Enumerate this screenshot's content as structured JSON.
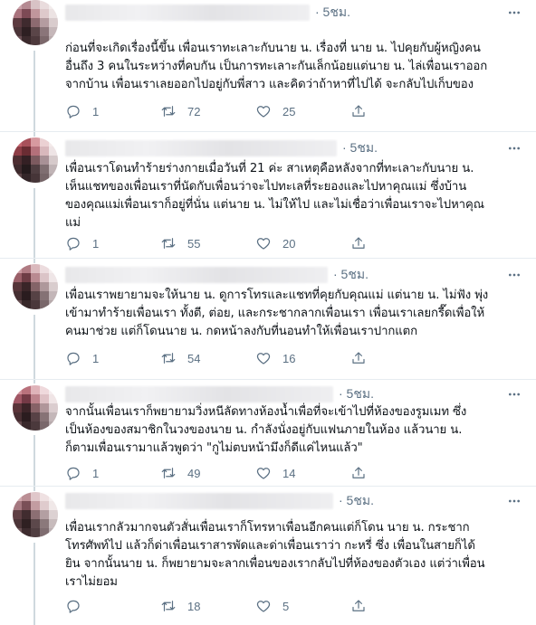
{
  "tweets": [
    {
      "time": "· 5ชม.",
      "text": "ก่อนที่จะเกิดเรื่องนี้ขึ้น เพื่อนเราทะเลาะกับนาย น. เรื่องที่ นาย น. ไปคุยกับผู้หญิงคน\nอื่นถึง 3 คนในระหว่างที่คบกัน เป็นการทะเลาะกันเล็กน้อยแต่นาย น. ไล่เพื่อนเราออก\nจากบ้าน เพื่อนเราเลยออกไปอยู่กับพี่สาว และคิดว่าถ้าหาที่ไปได้ จะกลับไปเก็บของ",
      "replies": "1",
      "retweets": "72",
      "likes": "25"
    },
    {
      "time": "· 5ชม.",
      "text": "เพื่อนเราโดนทำร้ายร่างกายเมื่อวันที่ 21 ค่ะ สาเหตุคือหลังจากที่ทะเลาะกับนาย น.\nเห็นแชทของเพื่อนเราที่นัดกับเพื่อนว่าจะไปทะเลที่ระยองและไปหาคุณแม่ ซึ่งบ้าน\nของคุณแม่เพื่อนเราก็อยู่ที่นั่น แต่นาย น. ไม่ให้ไป และไม่เชื่อว่าเพื่อนเราจะไปหาคุณ\nแม่",
      "replies": "1",
      "retweets": "55",
      "likes": "20"
    },
    {
      "time": "· 5ชม.",
      "text": "เพื่อนเราพยายามจะให้นาย น. ดูการโทรและแชทที่คุยกับคุณแม่ แต่นาย น. ไม่ฟัง พุ่ง\nเข้ามาทำร้ายเพื่อนเรา ทั้งตี, ต่อย, และกระชากลากเพื่อนเรา เพื่อนเราเลยกรี๊ดเพื่อให้\nคนมาช่วย แต่ก็โดนนาย น. กดหน้าลงกับที่นอนทำให้เพื่อนเราปากแตก",
      "replies": "1",
      "retweets": "54",
      "likes": "16"
    },
    {
      "time": "· 5ชม.",
      "text": "จากนั้นเพื่อนเราก็พยายามวิ่งหนีลัดทางห้องน้ำเพื่อที่จะเข้าไปที่ห้องของรูมเมท ซึ่ง\nเป็นห้องของสมาชิกในวงของนาย น. กำลังนั่งอยู่กับแฟนภายในห้อง แล้วนาย น.\nก็ตามเพื่อนเรามาแล้วพูดว่า \"กูไม่ตบหน้ามึงก็ดีแค่ไหนแล้ว\"",
      "replies": "1",
      "retweets": "49",
      "likes": "14"
    },
    {
      "time": "· 5ชม.",
      "text": "เพื่อนเรากลัวมากจนตัวสั่นเพื่อนเราก็โทรหาเพื่อนอีกคนแต่ก็โดน นาย น. กระชาก\nโทรศัพท์ไป แล้วก็ด่าเพื่อนเราสารพัดและด่าเพื่อนเราว่า กะหรี่ ซึ่ง เพื่อนในสายก็ได้\nยิน จากนั้นนาย น. ก็พยายามจะลากเพื่อนของเรากลับไปที่ห้องของตัวเอง แต่ว่าเพื่อน\nเราไม่ยอม",
      "replies": "",
      "retweets": "18",
      "likes": "5"
    }
  ],
  "icons": {
    "reply": "reply-icon",
    "retweet": "retweet-icon",
    "like": "like-icon",
    "share": "share-icon",
    "more": "more-options-icon"
  },
  "colors": {
    "muted": "#5b7083",
    "text": "#0f1419",
    "divider": "#e6ecf0",
    "thread": "#cfd9de"
  }
}
